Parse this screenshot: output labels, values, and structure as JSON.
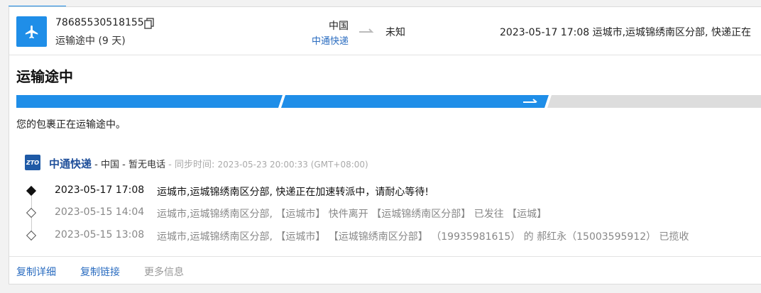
{
  "shipment": {
    "tracking_number": "78685530518155",
    "status_short": "运输途中 (9 天)",
    "origin_country": "中国",
    "carrier_link": "中通快递",
    "destination": "未知",
    "latest_event": "2023-05-17 17:08  运城市,运城锦绣南区分部, 快递正在"
  },
  "status": {
    "title": "运输途中",
    "description": "您的包裹正在运输途中。",
    "progress_stage": 2,
    "progress_total": 3
  },
  "carrier": {
    "logo_text": "ZTO",
    "name": "中通快递",
    "country": "中国",
    "phone": "暂无电话",
    "sync_label": "同步时间:",
    "sync_time": "2023-05-23 20:00:33 (GMT+08:00)"
  },
  "events": [
    {
      "time": "2023-05-17 17:08",
      "text": "运城市,运城锦绣南区分部, 快递正在加速转派中，请耐心等待!"
    },
    {
      "time": "2023-05-15 14:04",
      "text": "运城市,运城锦绣南区分部, 【运城市】 快件离开 【运城锦绣南区分部】 已发往 【运城】"
    },
    {
      "time": "2023-05-15 13:08",
      "text": "运城市,运城锦绣南区分部, 【运城市】 【运城锦绣南区分部】 （19935981615） 的 郝红永（15003595912） 已揽收"
    }
  ],
  "footer": {
    "copy_details": "复制详细",
    "copy_link": "复制链接",
    "more_info": "更多信息"
  },
  "colors": {
    "accent": "#1f8ee8",
    "progress_done": "#1f8ee8",
    "progress_todo": "#dddddd",
    "link": "#2a6cc0"
  }
}
